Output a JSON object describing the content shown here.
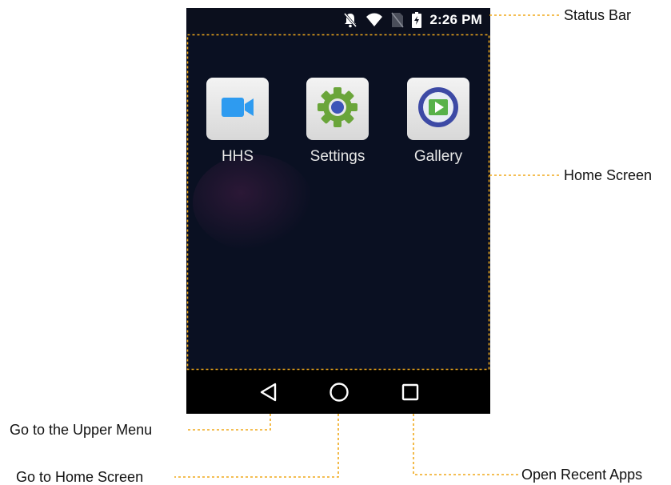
{
  "status_bar": {
    "time": "2:26 PM",
    "icons": [
      "bell-off-icon",
      "wifi-icon",
      "no-sim-icon",
      "battery-charging-icon"
    ]
  },
  "home_screen": {
    "apps": [
      {
        "label": "HHS",
        "icon": "video-camera-icon"
      },
      {
        "label": "Settings",
        "icon": "gear-icon"
      },
      {
        "label": "Gallery",
        "icon": "gallery-play-icon"
      }
    ]
  },
  "nav_bar": {
    "buttons": [
      "back-triangle-icon",
      "home-circle-icon",
      "recent-square-icon"
    ]
  },
  "callouts": {
    "status_bar": "Status Bar",
    "home_screen": "Home Screen",
    "upper_menu": "Go to the Upper Menu",
    "home": "Go to Home Screen",
    "recent_apps": "Open Recent Apps"
  },
  "colors": {
    "leader_line": "#f0a81a",
    "screen_bg": "#0a1022",
    "nav_bg": "#000000",
    "settings_gear": "#6aa53a",
    "hhs_camera": "#2e9bf0",
    "gallery_ring": "#3d4aa5"
  }
}
